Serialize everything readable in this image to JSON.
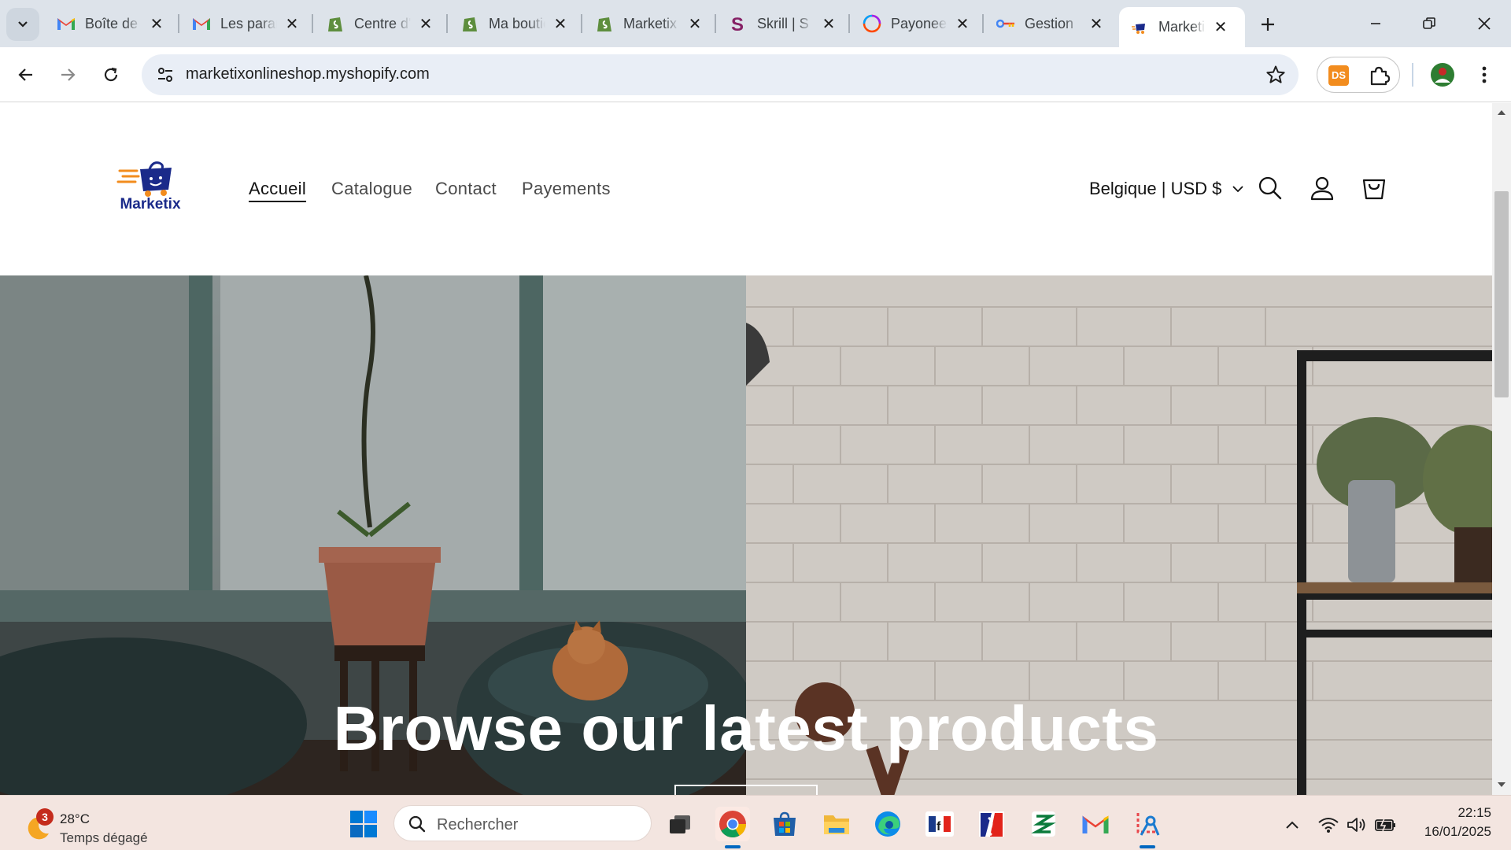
{
  "browser": {
    "tabs": [
      {
        "title": "Boîte de réception",
        "favicon": "gmail-icon",
        "active": false
      },
      {
        "title": "Les paramètres",
        "favicon": "gmail-icon",
        "active": false
      },
      {
        "title": "Centre d'aide",
        "favicon": "shopify-icon",
        "active": false
      },
      {
        "title": "Ma boutique",
        "favicon": "shopify-icon",
        "active": false
      },
      {
        "title": "Marketix",
        "favicon": "shopify-icon",
        "active": false
      },
      {
        "title": "Skrill | S",
        "favicon": "skrill-icon",
        "active": false
      },
      {
        "title": "Payoneer",
        "favicon": "payoneer-icon",
        "active": false
      },
      {
        "title": "Gestion",
        "favicon": "google-icon",
        "active": false
      },
      {
        "title": "Marketix",
        "favicon": "marketix-icon",
        "active": true
      }
    ],
    "url": "marketixonlineshop.myshopify.com",
    "extension_label": "DS"
  },
  "store": {
    "logo_text": "Marketix",
    "nav": [
      {
        "label": "Accueil",
        "active": true
      },
      {
        "label": "Catalogue",
        "active": false
      },
      {
        "label": "Contact",
        "active": false
      },
      {
        "label": "Payements",
        "active": false
      }
    ],
    "localization": "Belgique | USD $",
    "hero_heading": "Browse our latest products"
  },
  "taskbar": {
    "weather": {
      "temp": "28°C",
      "desc": "Temps dégagé",
      "badge": "3"
    },
    "search_placeholder": "Rechercher",
    "time": "22:15",
    "date": "16/01/2025",
    "apps": [
      "task-view-icon",
      "chrome-icon",
      "store-icon",
      "file-explorer-icon",
      "edge-icon",
      "france-app-icon",
      "france-gov-icon",
      "app-z-icon",
      "gmail-icon",
      "snipping-tool-icon"
    ]
  },
  "colors": {
    "tabstrip": "#dde3ea",
    "omnibox": "#e9eef6",
    "taskbar": "#f3e5e0",
    "logo_blue": "#1a2a8a",
    "logo_orange": "#f28c1e"
  }
}
